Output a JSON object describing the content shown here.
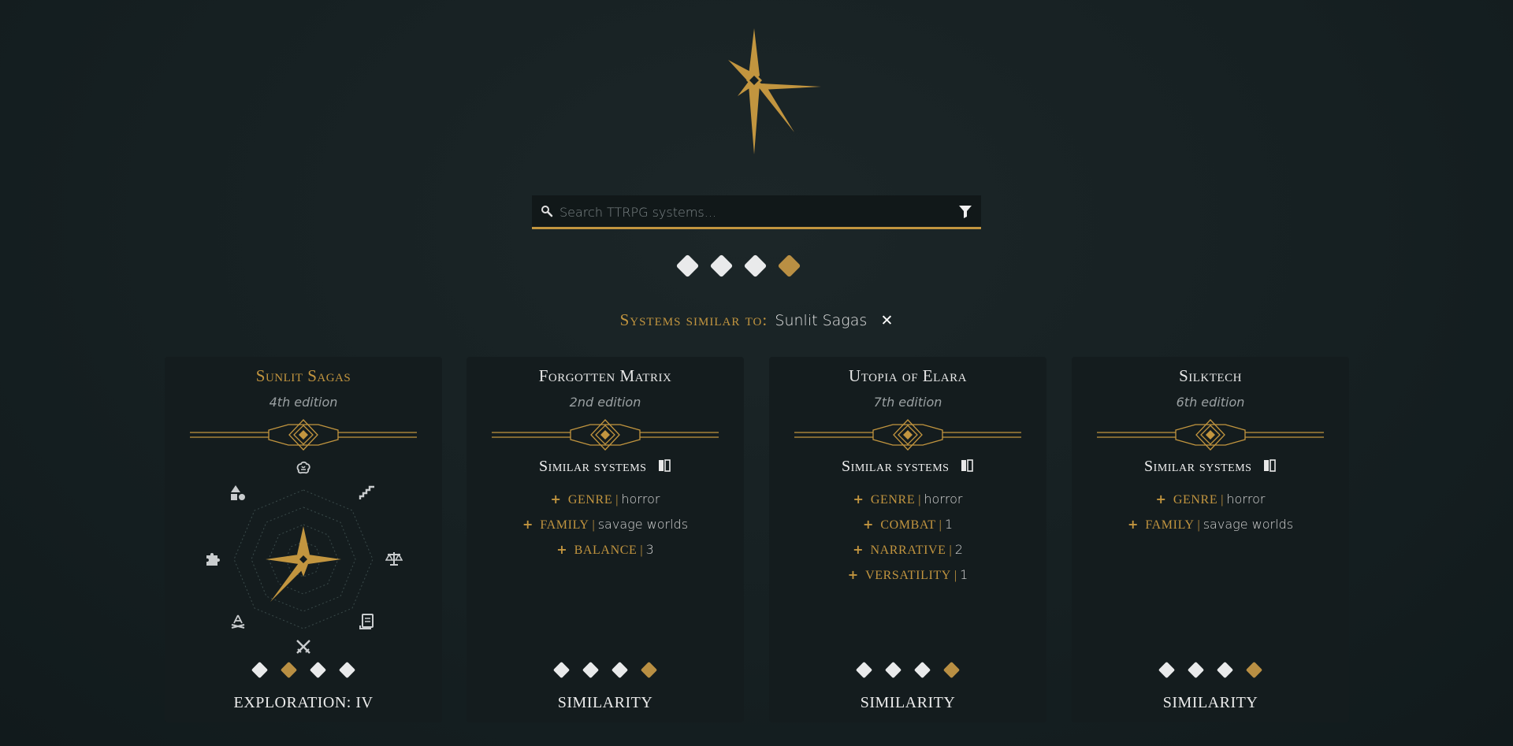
{
  "search": {
    "placeholder": "Search TTRPG systems..."
  },
  "modes": [
    {
      "active": false
    },
    {
      "active": false
    },
    {
      "active": false
    },
    {
      "active": true
    }
  ],
  "similar_to": {
    "label": "Systems similar to:",
    "name": "Sunlit Sagas"
  },
  "colors": {
    "accent": "#c2953f",
    "background": "#162022",
    "card": "#141c1e"
  },
  "cards": [
    {
      "title": "Sunlit Sagas",
      "edition": "4th edition",
      "footer": "EXPLORATION: IV",
      "diamonds_active_index": 1,
      "radar_icons": [
        "brain-icon",
        "stairs-icon",
        "scales-icon",
        "scroll-icon",
        "crossed-swords-icon",
        "campfire-icon",
        "puzzle-icon",
        "shapes-icon"
      ]
    },
    {
      "title": "Forgotten Matrix",
      "edition": "2nd edition",
      "similar_heading": "Similar systems",
      "criteria": [
        {
          "key": "GENRE",
          "value": "horror"
        },
        {
          "key": "FAMILY",
          "value": "savage worlds"
        },
        {
          "key": "BALANCE",
          "value": "3"
        }
      ],
      "footer": "SIMILARITY",
      "diamonds_active_index": 3
    },
    {
      "title": "Utopia of Elara",
      "edition": "7th edition",
      "similar_heading": "Similar systems",
      "criteria": [
        {
          "key": "GENRE",
          "value": "horror"
        },
        {
          "key": "COMBAT",
          "value": "1"
        },
        {
          "key": "NARRATIVE",
          "value": "2"
        },
        {
          "key": "VERSATILITY",
          "value": "1"
        }
      ],
      "footer": "SIMILARITY",
      "diamonds_active_index": 3
    },
    {
      "title": "Silktech",
      "edition": "6th edition",
      "similar_heading": "Similar systems",
      "criteria": [
        {
          "key": "GENRE",
          "value": "horror"
        },
        {
          "key": "FAMILY",
          "value": "savage worlds"
        }
      ],
      "footer": "SIMILARITY",
      "diamonds_active_index": 3
    }
  ]
}
